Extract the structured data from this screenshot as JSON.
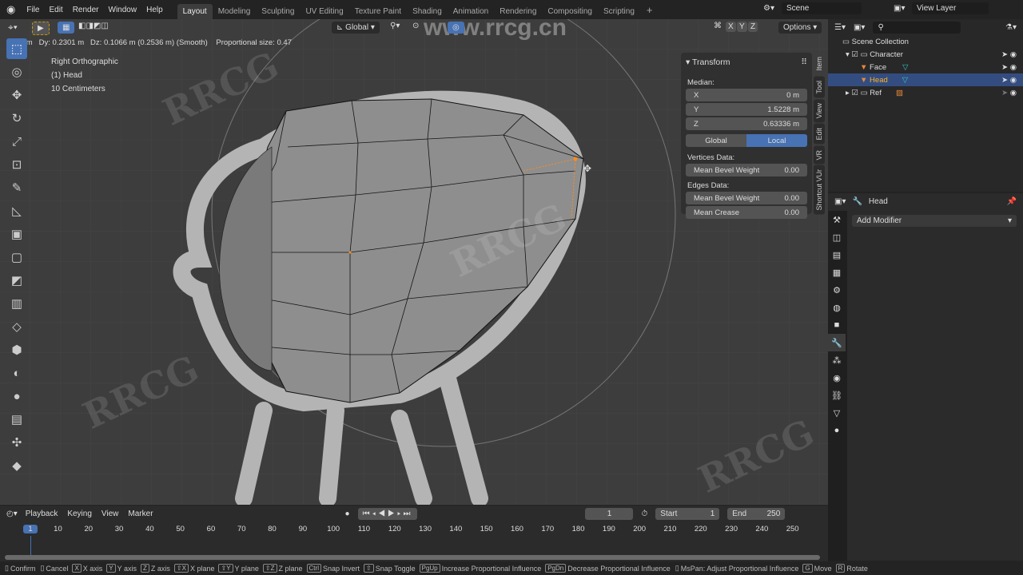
{
  "menubar": {
    "items": [
      "File",
      "Edit",
      "Render",
      "Window",
      "Help"
    ],
    "workspaces": [
      "Layout",
      "Modeling",
      "Sculpting",
      "UV Editing",
      "Texture Paint",
      "Shading",
      "Animation",
      "Rendering",
      "Compositing",
      "Scripting"
    ],
    "active_workspace": "Layout",
    "add": "+",
    "scene": "Scene",
    "view_layer": "View Layer"
  },
  "viewport": {
    "header_info": "Dx: 0 m   Dy: 0.2301 m   Dz: 0.1066 m (0.2536 m) (Smooth)    Proportional size: 0.47",
    "orientation": "Global",
    "axes": [
      "X",
      "Y",
      "Z"
    ],
    "options": "Options",
    "view_name": "Right Orthographic",
    "object": "(1) Head",
    "scale": "10 Centimeters",
    "watermark": "www.rrcg.cn"
  },
  "npanel": {
    "title": "Transform",
    "median": "Median:",
    "x_label": "X",
    "x": "0 m",
    "y_label": "Y",
    "y": "1.5228 m",
    "z_label": "Z",
    "z": "0.63336 m",
    "global": "Global",
    "local": "Local",
    "vertices": "Vertices Data:",
    "mbw_label": "Mean Bevel Weight",
    "mbw_v": "0.00",
    "edges": "Edges Data:",
    "mbw_e": "0.00",
    "crease_label": "Mean Crease",
    "crease": "0.00",
    "tabs": [
      "Item",
      "Tool",
      "View",
      "Edit",
      "VR",
      "Shortcut VUr"
    ]
  },
  "outliner": {
    "root": "Scene Collection",
    "items": [
      {
        "label": "Character"
      },
      {
        "label": "Face"
      },
      {
        "label": "Head"
      },
      {
        "label": "Ref"
      }
    ]
  },
  "properties": {
    "object": "Head",
    "add_modifier": "Add Modifier"
  },
  "timeline": {
    "menus": [
      "Playback",
      "Keying",
      "View",
      "Marker"
    ],
    "current": "1",
    "start_label": "Start",
    "start": "1",
    "end_label": "End",
    "end": "250",
    "ticks": [
      "1",
      "10",
      "20",
      "30",
      "40",
      "50",
      "60",
      "70",
      "80",
      "90",
      "100",
      "110",
      "120",
      "130",
      "140",
      "150",
      "160",
      "170",
      "180",
      "190",
      "200",
      "210",
      "220",
      "230",
      "240",
      "250"
    ]
  },
  "status": [
    {
      "k": "",
      "t": "Confirm"
    },
    {
      "k": "",
      "t": "Cancel"
    },
    {
      "k": "X",
      "t": "X axis"
    },
    {
      "k": "Y",
      "t": "Y axis"
    },
    {
      "k": "Z",
      "t": "Z axis"
    },
    {
      "k": "⇧X",
      "t": "X plane"
    },
    {
      "k": "⇧Y",
      "t": "Y plane"
    },
    {
      "k": "⇧Z",
      "t": "Z plane"
    },
    {
      "k": "Ctrl",
      "t": "Snap Invert"
    },
    {
      "k": "⇧",
      "t": "Snap Toggle"
    },
    {
      "k": "PgUp",
      "t": "Increase Proportional Influence"
    },
    {
      "k": "PgDn",
      "t": "Decrease Proportional Influence"
    },
    {
      "k": "",
      "t": "MsPan: Adjust Proportional Influence"
    },
    {
      "k": "G",
      "t": "Move"
    },
    {
      "k": "R",
      "t": "Rotate"
    }
  ],
  "colors": {
    "accent": "#4772b3",
    "selected_vertex": "#ff8c1a"
  }
}
